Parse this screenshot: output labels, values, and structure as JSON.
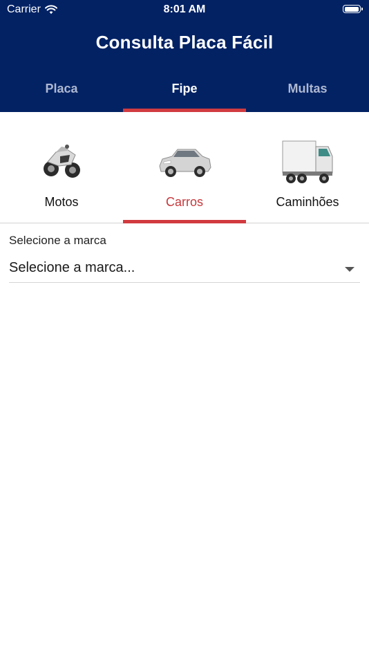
{
  "status_bar": {
    "carrier": "Carrier",
    "time": "8:01 AM",
    "icons": [
      "wifi-icon",
      "battery-icon"
    ]
  },
  "header": {
    "title": "Consulta Placa Fácil",
    "background_color": "#022264",
    "accent_color": "#d13b40"
  },
  "top_tabs": [
    {
      "label": "Placa",
      "active": false
    },
    {
      "label": "Fipe",
      "active": true
    },
    {
      "label": "Multas",
      "active": false
    }
  ],
  "vehicle_tabs": [
    {
      "label": "Motos",
      "icon": "motorcycle-icon",
      "active": false
    },
    {
      "label": "Carros",
      "icon": "car-icon",
      "active": true
    },
    {
      "label": "Caminhões",
      "icon": "truck-icon",
      "active": false
    }
  ],
  "form": {
    "brand_label": "Selecione a marca",
    "brand_placeholder": "Selecione a marca..."
  }
}
